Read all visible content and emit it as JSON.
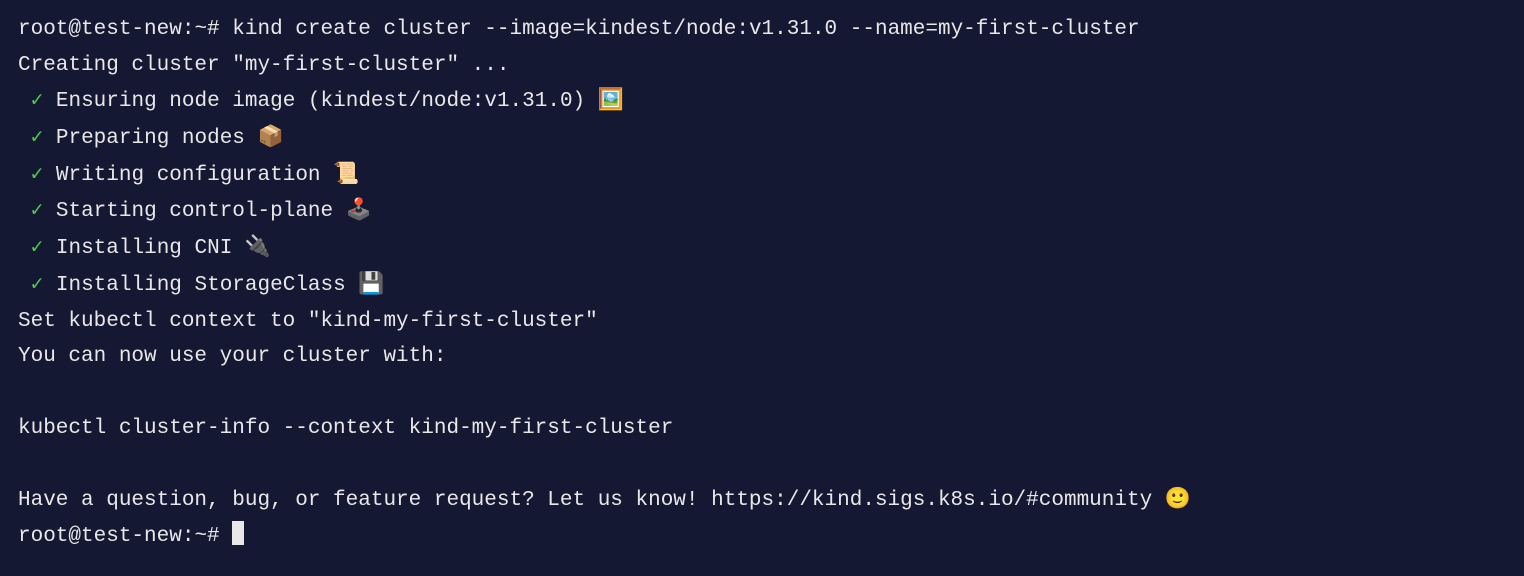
{
  "prompt1": {
    "user_host": "root@test-new",
    "sep": ":",
    "path": "~",
    "hash": "#"
  },
  "command1": "kind create cluster --image=kindest/node:v1.31.0 --name=my-first-cluster",
  "output": {
    "creating": "Creating cluster \"my-first-cluster\" ...",
    "steps": [
      {
        "check": "✓",
        "text": "Ensuring node image (kindest/node:v1.31.0)",
        "emoji": "🖼️"
      },
      {
        "check": "✓",
        "text": "Preparing nodes",
        "emoji": "📦"
      },
      {
        "check": "✓",
        "text": "Writing configuration",
        "emoji": "📜"
      },
      {
        "check": "✓",
        "text": "Starting control-plane",
        "emoji": "🕹️"
      },
      {
        "check": "✓",
        "text": "Installing CNI",
        "emoji": "🔌"
      },
      {
        "check": "✓",
        "text": "Installing StorageClass",
        "emoji": "💾"
      }
    ],
    "context_set": "Set kubectl context to \"kind-my-first-cluster\"",
    "use_cluster": "You can now use your cluster with:",
    "kubectl_cmd": "kubectl cluster-info --context kind-my-first-cluster",
    "question": "Have a question, bug, or feature request? Let us know! https://kind.sigs.k8s.io/#community",
    "question_emoji": "🙂"
  },
  "prompt2": {
    "user_host": "root@test-new",
    "sep": ":",
    "path": "~",
    "hash": "#"
  }
}
